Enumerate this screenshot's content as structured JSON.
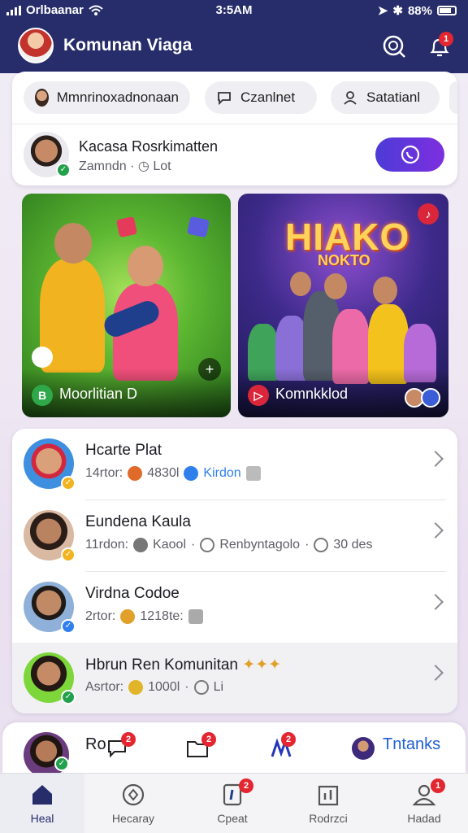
{
  "status_bar": {
    "carrier": "Orlbaanar",
    "time": "3:5AM",
    "battery": "88%"
  },
  "header": {
    "title": "Komunan Viaga",
    "notification_count": "1"
  },
  "chips": [
    {
      "label": "Mmnrinoxadnonaan"
    },
    {
      "label": "Czanlnet"
    },
    {
      "label": "Satatianl"
    }
  ],
  "profile": {
    "name": "Kacasa Rosrkimatten",
    "subtitle": "Zamndn",
    "status": "Lot"
  },
  "tiles": [
    {
      "label": "Moorlitian D"
    },
    {
      "title": "HIAKO",
      "subtitle": "NOKTO",
      "label": "Komnkklod"
    }
  ],
  "list": [
    {
      "name": "Hcarte Plat",
      "meta1": "14rtor:",
      "meta2": "4830l",
      "meta3": "Kirdon"
    },
    {
      "name": "Eundena Kaula",
      "meta1": "11rdon:",
      "meta2": "Kaool",
      "meta3": "Renbyntagolo",
      "meta4": "30 des"
    },
    {
      "name": "Virdna Codoe",
      "meta1": "2rtor:",
      "meta2": "1218te:"
    },
    {
      "name": "Hbrun Ren Komunitan",
      "meta1": "Asrtor:",
      "meta2": "1000l",
      "meta3": "Li"
    }
  ],
  "quick_bar": {
    "label": "Ro",
    "link": "Tntanks",
    "badges": [
      "2",
      "2",
      "2"
    ]
  },
  "nav": [
    {
      "label": "Heal"
    },
    {
      "label": "Hecaray"
    },
    {
      "label": "Cpeat",
      "badge": "2"
    },
    {
      "label": "Rodrzci"
    },
    {
      "label": "Hadad",
      "badge": "1"
    }
  ],
  "colors": {
    "header_bg": "#272d6b",
    "accent": "#5b35d9",
    "badge": "#e3262f",
    "verified": "#22a04b"
  }
}
